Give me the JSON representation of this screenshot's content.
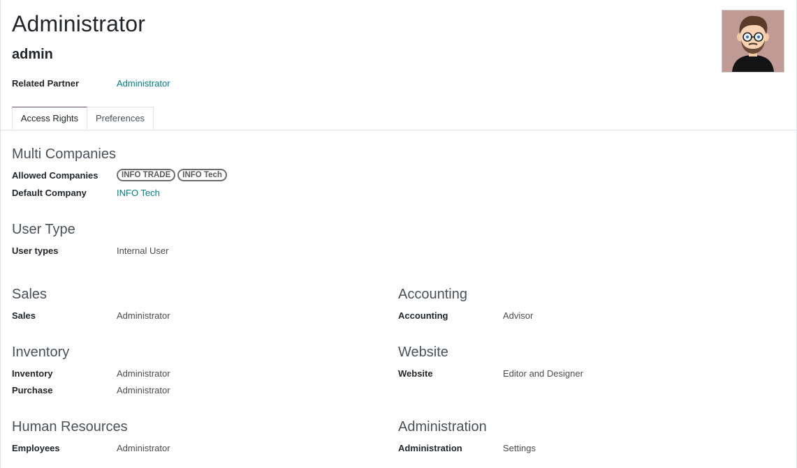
{
  "header": {
    "title": "Administrator",
    "login": "admin",
    "related_partner_label": "Related Partner",
    "related_partner_value": "Administrator"
  },
  "tabs": [
    {
      "label": "Access Rights",
      "active": true
    },
    {
      "label": "Preferences",
      "active": false
    }
  ],
  "multi_companies": {
    "title": "Multi Companies",
    "allowed_label": "Allowed Companies",
    "allowed_tags": [
      "INFO TRADE",
      "INFO Tech"
    ],
    "default_label": "Default Company",
    "default_value": "INFO Tech"
  },
  "user_type": {
    "title": "User Type",
    "label": "User types",
    "value": "Internal User"
  },
  "sales": {
    "title": "Sales",
    "rows": [
      {
        "label": "Sales",
        "value": "Administrator"
      }
    ]
  },
  "accounting": {
    "title": "Accounting",
    "rows": [
      {
        "label": "Accounting",
        "value": "Advisor"
      }
    ]
  },
  "inventory": {
    "title": "Inventory",
    "rows": [
      {
        "label": "Inventory",
        "value": "Administrator"
      },
      {
        "label": "Purchase",
        "value": "Administrator"
      }
    ]
  },
  "website": {
    "title": "Website",
    "rows": [
      {
        "label": "Website",
        "value": "Editor and Designer"
      }
    ]
  },
  "human_resources": {
    "title": "Human Resources",
    "rows": [
      {
        "label": "Employees",
        "value": "Administrator"
      }
    ]
  },
  "administration": {
    "title": "Administration",
    "rows": [
      {
        "label": "Administration",
        "value": "Settings"
      }
    ]
  },
  "colors": {
    "link": "#017e84",
    "tab_accent": "#714b67",
    "avatar_bg": "#c09a95"
  }
}
